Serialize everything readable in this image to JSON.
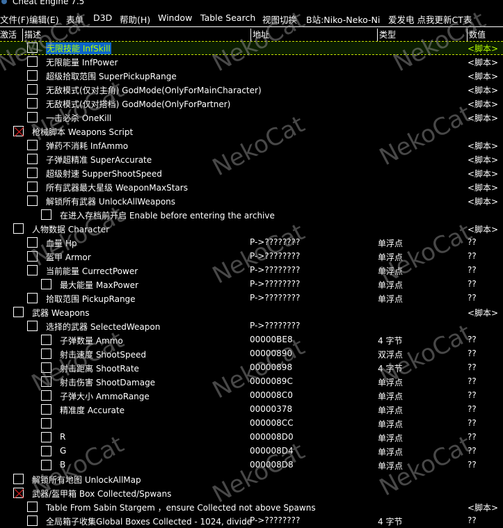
{
  "window": {
    "title": "Cheat Engine 7.5"
  },
  "menu": [
    "文件(F)",
    "编辑(E)",
    "表单",
    "D3D",
    "帮助(H)",
    "Window",
    "Table Search",
    "视图切换",
    "B站:Niko-Neko-Ni",
    "爱发电 点我更新CT表"
  ],
  "columns": {
    "active": "激活",
    "description": "描述",
    "address": "地址",
    "type": "类型",
    "value": "数值"
  },
  "watermark": "NekoCat",
  "rows": [
    {
      "level": 1,
      "checked": false,
      "selected": true,
      "desc": "无限技能 InfSkill",
      "addr": "",
      "type": "",
      "value": "<脚本>"
    },
    {
      "level": 1,
      "checked": false,
      "desc": "无限能量 InfPower",
      "addr": "",
      "type": "",
      "value": "<脚本>"
    },
    {
      "level": 1,
      "checked": false,
      "desc": "超级拾取范围 SuperPickupRange",
      "addr": "",
      "type": "",
      "value": "<脚本>"
    },
    {
      "level": 1,
      "checked": false,
      "desc": "无敌模式(仅对主角) GodMode(OnlyForMainCharacter)",
      "addr": "",
      "type": "",
      "value": "<脚本>"
    },
    {
      "level": 1,
      "checked": false,
      "desc": "无敌模式(仅对搭档) GodMode(OnlyForPartner)",
      "addr": "",
      "type": "",
      "value": "<脚本>"
    },
    {
      "level": 1,
      "checked": false,
      "desc": "一击必杀 OneKill",
      "addr": "",
      "type": "",
      "value": "<脚本>"
    },
    {
      "level": 0,
      "checked": true,
      "desc": "枪械脚本 Weapons Script",
      "addr": "",
      "type": "",
      "value": ""
    },
    {
      "level": 1,
      "checked": false,
      "desc": "弹药不消耗 InfAmmo",
      "addr": "",
      "type": "",
      "value": "<脚本>"
    },
    {
      "level": 1,
      "checked": false,
      "desc": "子弹超精准 SuperAccurate",
      "addr": "",
      "type": "",
      "value": "<脚本>"
    },
    {
      "level": 1,
      "checked": false,
      "desc": "超级射速 SupperShootSpeed",
      "addr": "",
      "type": "",
      "value": "<脚本>"
    },
    {
      "level": 1,
      "checked": false,
      "desc": "所有武器最大星级 WeaponMaxStars",
      "addr": "",
      "type": "",
      "value": "<脚本>"
    },
    {
      "level": 1,
      "checked": false,
      "desc": "解锁所有武器 UnlockAllWeapons",
      "addr": "",
      "type": "",
      "value": "<脚本>"
    },
    {
      "level": 2,
      "checked": false,
      "desc": "在进入存档前开启 Enable before entering the archive",
      "addr": "",
      "type": "",
      "value": ""
    },
    {
      "level": 0,
      "checked": false,
      "desc": "人物数据 Character",
      "addr": "",
      "type": "",
      "value": "<脚本>"
    },
    {
      "level": 1,
      "checked": false,
      "desc": "血量 Hp",
      "addr": "P->????????",
      "type": "单浮点",
      "value": "??"
    },
    {
      "level": 1,
      "checked": false,
      "desc": "盔甲 Armor",
      "addr": "P->????????",
      "type": "单浮点",
      "value": "??"
    },
    {
      "level": 1,
      "checked": false,
      "desc": "当前能量 CurrectPower",
      "addr": "P->????????",
      "type": "单浮点",
      "value": "??"
    },
    {
      "level": 2,
      "checked": false,
      "desc": "最大能量 MaxPower",
      "addr": "P->????????",
      "type": "单浮点",
      "value": "??"
    },
    {
      "level": 1,
      "checked": false,
      "desc": "拾取范围 PickupRange",
      "addr": "P->????????",
      "type": "单浮点",
      "value": "??"
    },
    {
      "level": 0,
      "checked": false,
      "desc": "武器 Weapons",
      "addr": "",
      "type": "",
      "value": "<脚本>"
    },
    {
      "level": 1,
      "checked": false,
      "desc": "选择的武器 SelectedWeapon",
      "addr": "P->????????",
      "type": "",
      "value": ""
    },
    {
      "level": 2,
      "checked": false,
      "desc": "子弹数量 Ammo",
      "addr": "00000BE8",
      "type": "4 字节",
      "value": "??"
    },
    {
      "level": 2,
      "checked": false,
      "desc": "射击速度 ShootSpeed",
      "addr": "00000890",
      "type": "双浮点",
      "value": "??"
    },
    {
      "level": 2,
      "checked": false,
      "desc": "射击距离 ShootRate",
      "addr": "00000898",
      "type": "4 字节",
      "value": "??"
    },
    {
      "level": 2,
      "checked": false,
      "desc": "射击伤害 ShootDamage",
      "addr": "0000089C",
      "type": "单浮点",
      "value": "??"
    },
    {
      "level": 2,
      "checked": false,
      "desc": "子弹大小 AmmoRange",
      "addr": "000008C0",
      "type": "单浮点",
      "value": "??"
    },
    {
      "level": 2,
      "checked": false,
      "desc": "精准度 Accurate",
      "addr": "00000378",
      "type": "单浮点",
      "value": "??"
    },
    {
      "level": 2,
      "checked": false,
      "desc": "",
      "addr": "000008CC",
      "type": "单浮点",
      "value": "??"
    },
    {
      "level": 2,
      "checked": false,
      "desc": "R",
      "addr": "000008D0",
      "type": "单浮点",
      "value": "??"
    },
    {
      "level": 2,
      "checked": false,
      "desc": "G",
      "addr": "000008D4",
      "type": "单浮点",
      "value": "??"
    },
    {
      "level": 2,
      "checked": false,
      "desc": "B",
      "addr": "000008D8",
      "type": "单浮点",
      "value": "??"
    },
    {
      "level": 0,
      "checked": false,
      "desc": "解锁所有地图 UnlockAllMap",
      "addr": "",
      "type": "",
      "value": ""
    },
    {
      "level": 0,
      "checked": true,
      "desc": "武器/盔甲箱 Box Collected/Spwans",
      "addr": "",
      "type": "",
      "value": ""
    },
    {
      "level": 1,
      "checked": false,
      "desc": "Table From Sabin Stargem ，ensure Collected not above Spawns",
      "addr": "",
      "type": "",
      "value": "<脚本>"
    },
    {
      "level": 1,
      "checked": false,
      "desc": "全局箱子收集Global Boxes Collected - 1024, divide",
      "addr": "P->????????",
      "type": "4 字节",
      "value": "??"
    }
  ]
}
